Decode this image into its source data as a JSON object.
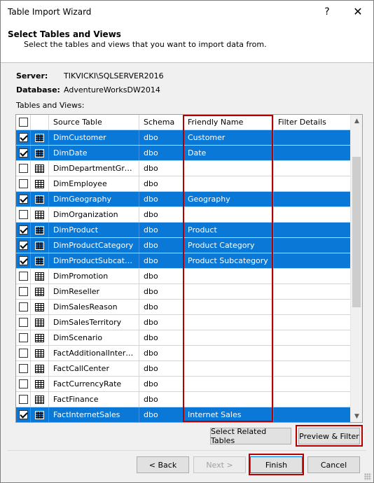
{
  "window": {
    "title": "Table Import Wizard",
    "help_glyph": "?",
    "close_glyph": "✕"
  },
  "header": {
    "title": "Select Tables and Views",
    "subtitle": "Select the tables and views that you want to import data from."
  },
  "connection": {
    "server_label": "Server:",
    "server_value": "TIKVICKI\\SQLSERVER2016",
    "database_label": "Database:",
    "database_value": "AdventureWorksDW2014"
  },
  "tables_label": "Tables and Views:",
  "grid": {
    "columns": [
      "Source Table",
      "Schema",
      "Friendly Name",
      "Filter Details"
    ],
    "rows": [
      {
        "checked": true,
        "source": "DimCustomer",
        "schema": "dbo",
        "friendly": "Customer",
        "filter": ""
      },
      {
        "checked": true,
        "source": "DimDate",
        "schema": "dbo",
        "friendly": "Date",
        "filter": ""
      },
      {
        "checked": false,
        "source": "DimDepartmentGroup",
        "schema": "dbo",
        "friendly": "",
        "filter": ""
      },
      {
        "checked": false,
        "source": "DimEmployee",
        "schema": "dbo",
        "friendly": "",
        "filter": ""
      },
      {
        "checked": true,
        "source": "DimGeography",
        "schema": "dbo",
        "friendly": "Geography",
        "filter": ""
      },
      {
        "checked": false,
        "source": "DimOrganization",
        "schema": "dbo",
        "friendly": "",
        "filter": ""
      },
      {
        "checked": true,
        "source": "DimProduct",
        "schema": "dbo",
        "friendly": "Product",
        "filter": ""
      },
      {
        "checked": true,
        "source": "DimProductCategory",
        "schema": "dbo",
        "friendly": "Product Category",
        "filter": ""
      },
      {
        "checked": true,
        "source": "DimProductSubcategory",
        "schema": "dbo",
        "friendly": "Product Subcategory",
        "filter": ""
      },
      {
        "checked": false,
        "source": "DimPromotion",
        "schema": "dbo",
        "friendly": "",
        "filter": ""
      },
      {
        "checked": false,
        "source": "DimReseller",
        "schema": "dbo",
        "friendly": "",
        "filter": ""
      },
      {
        "checked": false,
        "source": "DimSalesReason",
        "schema": "dbo",
        "friendly": "",
        "filter": ""
      },
      {
        "checked": false,
        "source": "DimSalesTerritory",
        "schema": "dbo",
        "friendly": "",
        "filter": ""
      },
      {
        "checked": false,
        "source": "DimScenario",
        "schema": "dbo",
        "friendly": "",
        "filter": ""
      },
      {
        "checked": false,
        "source": "FactAdditionalInterna...",
        "schema": "dbo",
        "friendly": "",
        "filter": ""
      },
      {
        "checked": false,
        "source": "FactCallCenter",
        "schema": "dbo",
        "friendly": "",
        "filter": ""
      },
      {
        "checked": false,
        "source": "FactCurrencyRate",
        "schema": "dbo",
        "friendly": "",
        "filter": ""
      },
      {
        "checked": false,
        "source": "FactFinance",
        "schema": "dbo",
        "friendly": "",
        "filter": ""
      },
      {
        "checked": true,
        "source": "FactInternetSales",
        "schema": "dbo",
        "friendly": "Internet Sales",
        "filter": ""
      }
    ]
  },
  "buttons": {
    "select_related": "Select Related Tables",
    "preview_filter": "Preview & Filter",
    "back": "< Back",
    "next": "Next >",
    "finish": "Finish",
    "cancel": "Cancel"
  },
  "colors": {
    "selection": "#0a78d7",
    "highlight_outline": "#b40000",
    "header_rule": "#e3c170"
  }
}
